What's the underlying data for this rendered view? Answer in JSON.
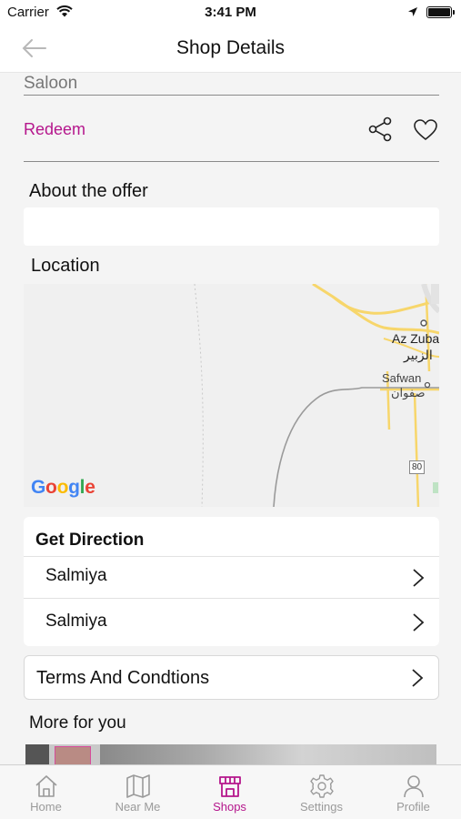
{
  "status_bar": {
    "carrier": "Carrier",
    "time": "3:41 PM"
  },
  "header": {
    "title": "Shop Details",
    "back_icon": "arrow-left-icon"
  },
  "shop": {
    "name": "Saloon"
  },
  "actions": {
    "redeem_label": "Redeem",
    "share_icon": "share-icon",
    "favorite_icon": "heart-icon"
  },
  "about": {
    "title": "About the offer",
    "description": ""
  },
  "location": {
    "title": "Location",
    "map_labels": [
      "Az Zubair",
      "الزبير",
      "Safwan",
      "صفوان"
    ],
    "road_shield": "80",
    "provider": "Google"
  },
  "directions": {
    "title": "Get Direction",
    "items": [
      {
        "label": "Salmiya"
      },
      {
        "label": "Salmiya"
      }
    ]
  },
  "terms": {
    "label": "Terms And Condtions"
  },
  "more": {
    "title": "More for you"
  },
  "tabs": [
    {
      "label": "Home",
      "icon": "home-icon",
      "active": false
    },
    {
      "label": "Near Me",
      "icon": "map-icon",
      "active": false
    },
    {
      "label": "Shops",
      "icon": "shop-icon",
      "active": true
    },
    {
      "label": "Settings",
      "icon": "gear-icon",
      "active": false
    },
    {
      "label": "Profile",
      "icon": "user-icon",
      "active": false
    }
  ],
  "colors": {
    "accent": "#b5168c",
    "road_major": "#f7d66b",
    "inactive_tab": "#9a9a9a"
  }
}
